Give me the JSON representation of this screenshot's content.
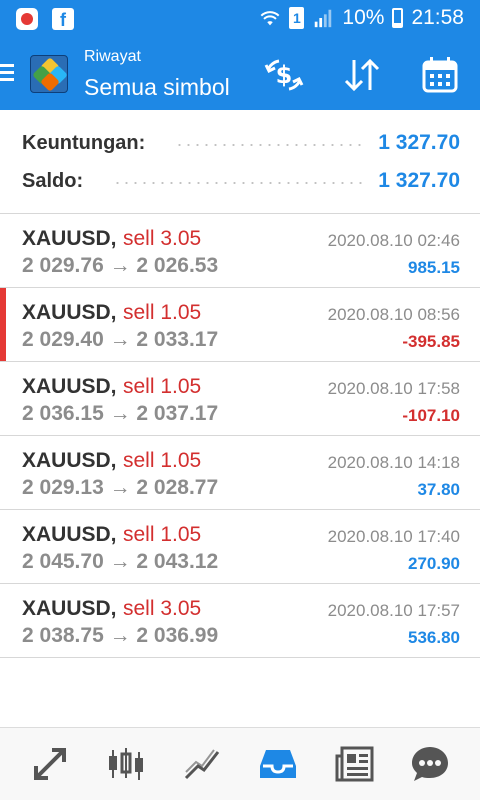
{
  "status_bar": {
    "battery_text": "10%",
    "time": "21:58",
    "sim_label": "1"
  },
  "header": {
    "subtitle": "Riwayat",
    "title": "Semua simbol",
    "icons": [
      "currency-exchange-icon",
      "sort-arrows-icon",
      "calendar-icon"
    ]
  },
  "summary": {
    "profit_label": "Keuntungan:",
    "profit_value": "1 327.70",
    "balance_label": "Saldo:",
    "balance_value": "1 327.70"
  },
  "trades": [
    {
      "symbol": "XAUUSD,",
      "side": "sell 3.05",
      "prices": "2 029.76 → 2 026.53",
      "time": "2020.08.10 02:46",
      "profit": "985.15",
      "profit_color": "#1e88e5",
      "marked": false
    },
    {
      "symbol": "XAUUSD,",
      "side": "sell 1.05",
      "prices": "2 029.40 → 2 033.17",
      "time": "2020.08.10 08:56",
      "profit": "-395.85",
      "profit_color": "#d32f2f",
      "marked": true
    },
    {
      "symbol": "XAUUSD,",
      "side": "sell 1.05",
      "prices": "2 036.15 → 2 037.17",
      "time": "2020.08.10 17:58",
      "profit": "-107.10",
      "profit_color": "#d32f2f",
      "marked": false
    },
    {
      "symbol": "XAUUSD,",
      "side": "sell 1.05",
      "prices": "2 029.13 → 2 028.77",
      "time": "2020.08.10 14:18",
      "profit": "37.80",
      "profit_color": "#1e88e5",
      "marked": false
    },
    {
      "symbol": "XAUUSD,",
      "side": "sell 1.05",
      "prices": "2 045.70 → 2 043.12",
      "time": "2020.08.10 17:40",
      "profit": "270.90",
      "profit_color": "#1e88e5",
      "marked": false
    },
    {
      "symbol": "XAUUSD,",
      "side": "sell 3.05",
      "prices": "2 038.75 → 2 036.99",
      "time": "2020.08.10 17:57",
      "profit": "536.80",
      "profit_color": "#1e88e5",
      "marked": false
    }
  ],
  "bottom_nav": {
    "items": [
      "quotes-icon",
      "chart-icon",
      "trade-icon",
      "history-icon",
      "news-icon",
      "chat-icon"
    ],
    "active": "history-icon"
  },
  "colors": {
    "accent": "#1e88e5",
    "loss": "#d32f2f",
    "muted": "#8c8c8c"
  }
}
